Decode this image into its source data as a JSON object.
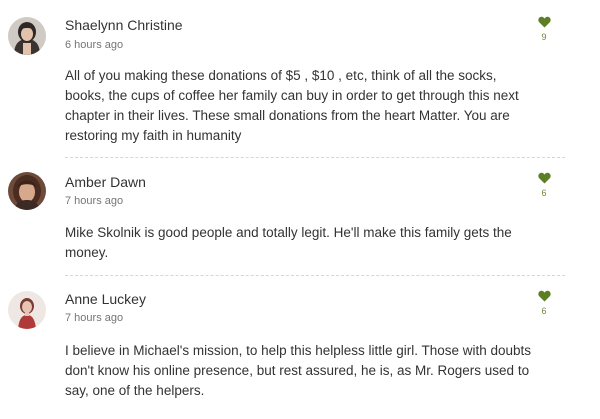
{
  "comments": [
    {
      "author": "Shaelynn Christine",
      "time": "6 hours ago",
      "text": "All of you making these donations of $5 , $10 , etc, think of all the socks, books, the cups of coffee her family can buy in order to get through this next chapter in their lives. These small donations from the heart Matter. You are restoring my faith in humanity",
      "likes": "9",
      "avatar_icon": "avatar-photo"
    },
    {
      "author": "Amber Dawn",
      "time": "7 hours ago",
      "text": "Mike Skolnik is good people and totally legit. He'll make this family gets the money.",
      "likes": "6",
      "avatar_icon": "avatar-photo"
    },
    {
      "author": "Anne Luckey",
      "time": "7 hours ago",
      "text": "I believe in Michael's mission, to help this helpless little girl. Those with doubts don't know his online presence, but rest assured, he is, as Mr. Rogers used to say, one of the helpers.",
      "likes": "6",
      "avatar_icon": "avatar-photo"
    }
  ],
  "colors": {
    "heart": "#5b7f22",
    "like_count": "#6d8c3a",
    "text": "#333333",
    "timestamp": "#757575",
    "divider": "#d6d6d6"
  }
}
